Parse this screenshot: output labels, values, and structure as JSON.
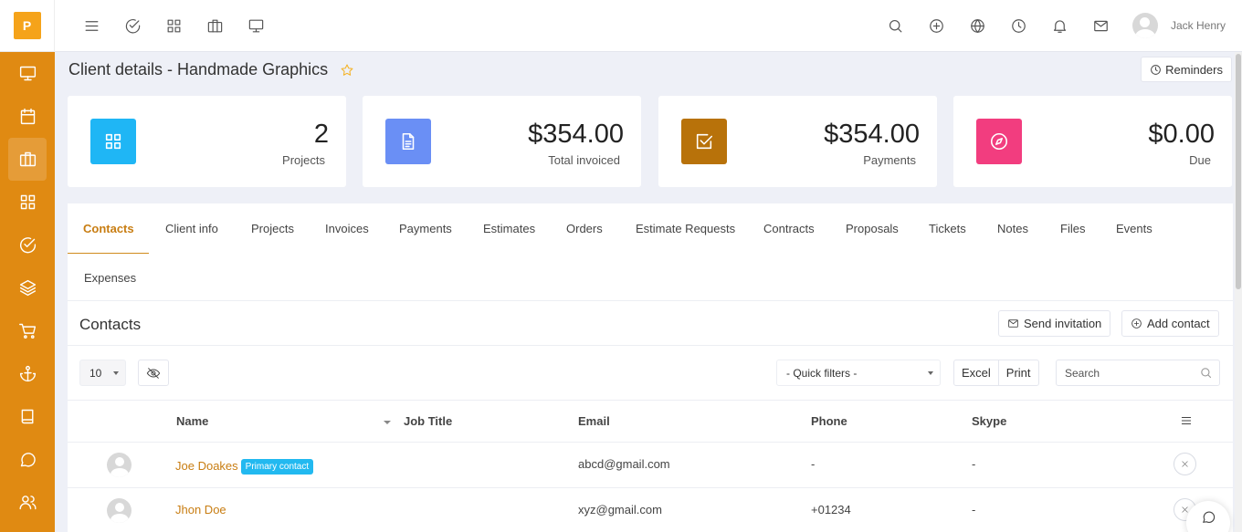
{
  "app": {
    "logo_letter": "P"
  },
  "sidebar": {
    "items": [
      {
        "icon": "monitor-icon"
      },
      {
        "icon": "calendar-icon"
      },
      {
        "icon": "briefcase-icon",
        "active": true
      },
      {
        "icon": "grid-icon"
      },
      {
        "icon": "check-circle-icon"
      },
      {
        "icon": "layers-icon"
      },
      {
        "icon": "cart-icon"
      },
      {
        "icon": "anchor-icon"
      },
      {
        "icon": "book-icon"
      },
      {
        "icon": "chat-icon"
      },
      {
        "icon": "users-icon"
      }
    ]
  },
  "topbar": {
    "left_icons": [
      "menu-icon",
      "check-circle-icon",
      "grid-icon",
      "briefcase-icon",
      "monitor-icon"
    ],
    "right_icons": [
      "search-icon",
      "plus-circle-icon",
      "globe-icon",
      "clock-icon",
      "bell-icon",
      "mail-icon"
    ],
    "user_name": "Jack Henry"
  },
  "page": {
    "title": "Client details - Handmade Graphics",
    "reminders_label": "Reminders"
  },
  "stats": [
    {
      "value": "2",
      "label": "Projects",
      "color": "#1fb6f5",
      "icon": "grid-icon"
    },
    {
      "value": "$354.00",
      "label": "Total invoiced",
      "color": "#6a8ff5",
      "icon": "document-icon"
    },
    {
      "value": "$354.00",
      "label": "Payments",
      "color": "#b8720a",
      "icon": "check-square-icon"
    },
    {
      "value": "$0.00",
      "label": "Due",
      "color": "#f23d7f",
      "icon": "compass-icon"
    }
  ],
  "tabs": [
    "Contacts",
    "Client info",
    "Projects",
    "Invoices",
    "Payments",
    "Estimates",
    "Orders",
    "Estimate Requests",
    "Contracts",
    "Proposals",
    "Tickets",
    "Notes",
    "Files",
    "Events",
    "Expenses"
  ],
  "contacts": {
    "title": "Contacts",
    "send_invitation": "Send invitation",
    "add_contact": "Add contact",
    "page_size": "10",
    "quick_filters": "- Quick filters -",
    "excel": "Excel",
    "print": "Print",
    "search_placeholder": "Search",
    "columns": [
      "Name",
      "Job Title",
      "Email",
      "Phone",
      "Skype"
    ],
    "rows": [
      {
        "name": "Joe Doakes",
        "badge": "Primary contact",
        "job_title": "",
        "email": "abcd@gmail.com",
        "phone": "-",
        "skype": "-"
      },
      {
        "name": "Jhon Doe",
        "badge": "",
        "job_title": "",
        "email": "xyz@gmail.com",
        "phone": "+01234",
        "skype": "-"
      }
    ]
  },
  "colors": {
    "accent": "#e08a12",
    "link": "#c87d12",
    "badge": "#22b9f0"
  }
}
